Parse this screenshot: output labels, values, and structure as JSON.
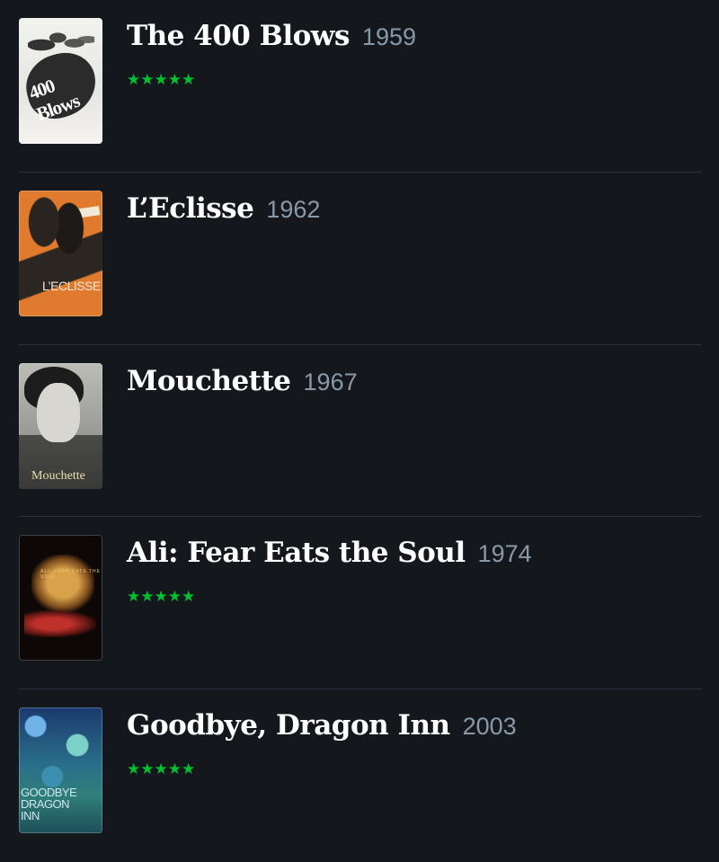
{
  "colors": {
    "background": "#14181c",
    "title": "#ffffff",
    "year": "#8899aa",
    "rating_stars": "#00c030",
    "divider": "#2c3440"
  },
  "films": [
    {
      "title": "The 400 Blows",
      "year": "1959",
      "rating": "★★★★★",
      "poster_text": "400 Blows",
      "poster_icon": "poster-400-blows"
    },
    {
      "title": "L’Eclisse",
      "year": "1962",
      "rating": "",
      "poster_text": "L’ECLISSE",
      "poster_icon": "poster-leclisse"
    },
    {
      "title": "Mouchette",
      "year": "1967",
      "rating": "",
      "poster_text": "Mouchette",
      "poster_icon": "poster-mouchette"
    },
    {
      "title": "Ali: Fear Eats the Soul",
      "year": "1974",
      "rating": "★★★★★",
      "poster_text": "ALI: FEAR EATS THE SOUL",
      "poster_icon": "poster-ali-fear-eats-the-soul"
    },
    {
      "title": "Goodbye, Dragon Inn",
      "year": "2003",
      "rating": "★★★★★",
      "poster_text": "GOODBYE\nDRAGON\nINN",
      "poster_icon": "poster-goodbye-dragon-inn"
    }
  ]
}
